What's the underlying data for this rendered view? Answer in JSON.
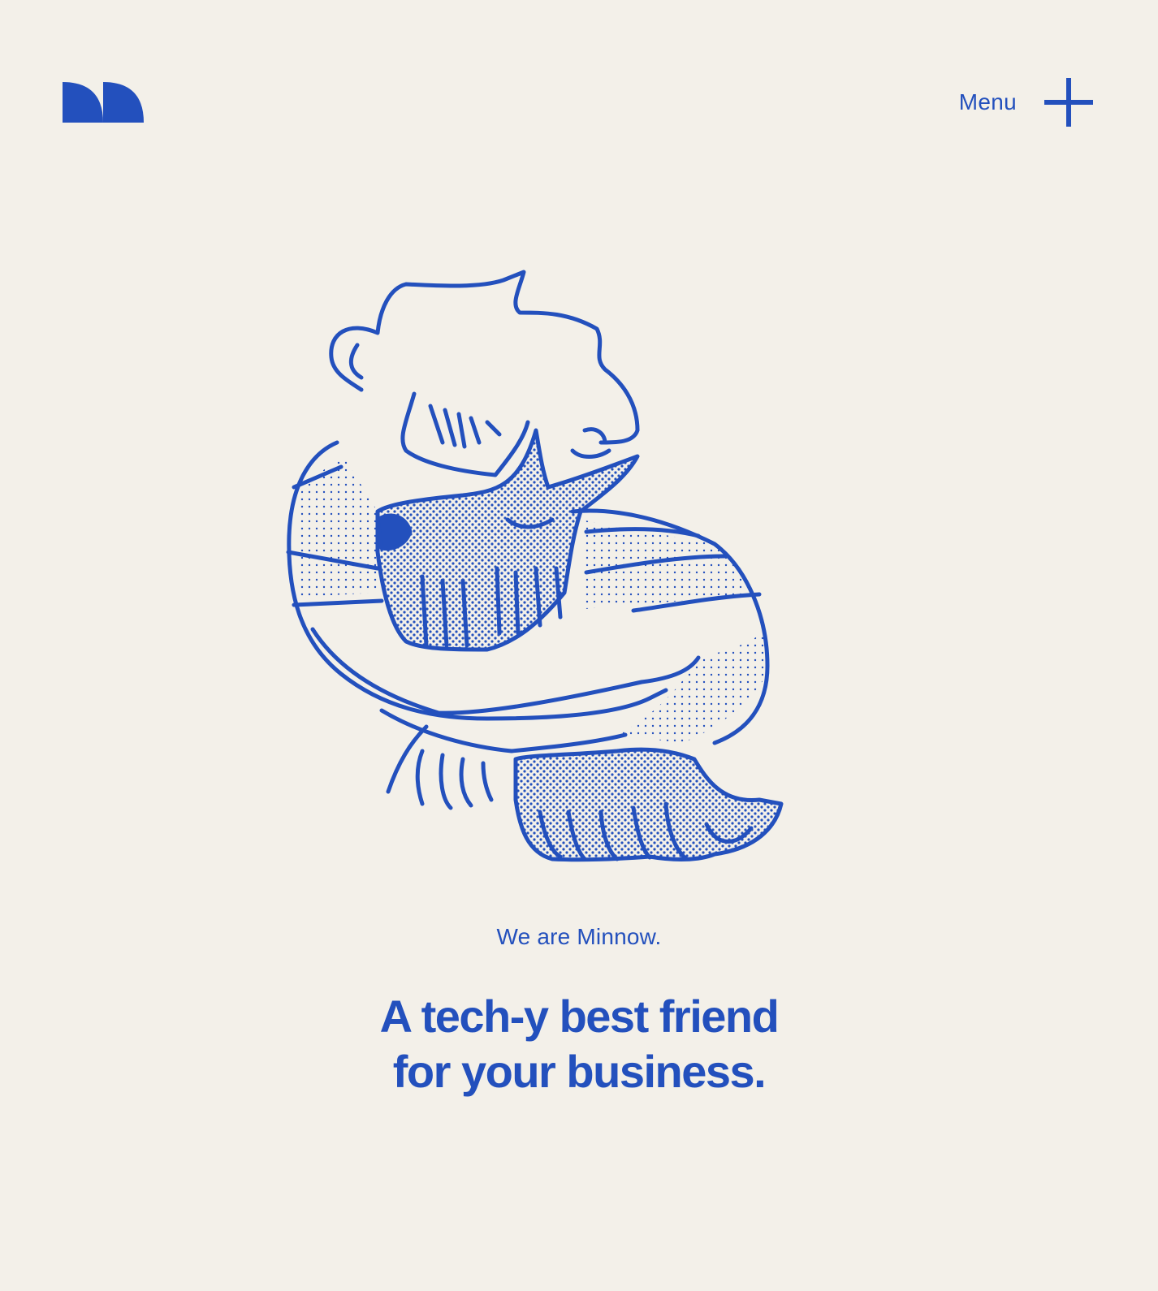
{
  "header": {
    "logo_name": "Minnow logo",
    "menu_label": "Menu",
    "menu_icon": "plus-icon"
  },
  "hero": {
    "illustration": "person-hugging-dog-illustration",
    "tagline": "We are Minnow.",
    "headline_line1": "A tech-y best friend",
    "headline_line2": "for your business."
  },
  "colors": {
    "background": "#F3F0E9",
    "brand_blue": "#2350BD"
  }
}
